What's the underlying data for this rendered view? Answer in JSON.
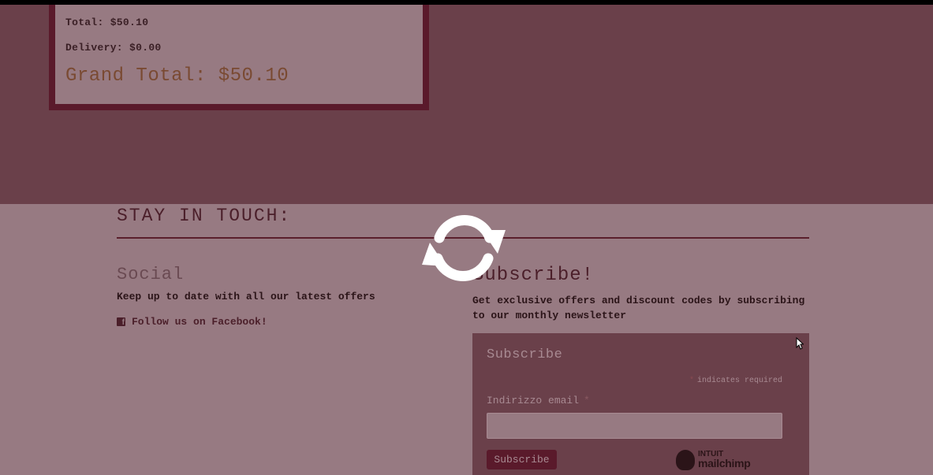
{
  "order": {
    "total_line": "Total: $50.10",
    "delivery_line": "Delivery: $0.00",
    "grand_total_line": "Grand Total: $50.10"
  },
  "footer": {
    "heading": "STAY IN TOUCH:",
    "social": {
      "heading": "Social",
      "text": "Keep up to date with all our latest offers",
      "facebook_link": "Follow us on Facebook!",
      "facebook_icon": "facebook-square-icon"
    },
    "subscribe": {
      "heading": "Subscribe!",
      "text": "Get exclusive offers and discount codes by subscribing to our monthly newsletter"
    },
    "form": {
      "title": "Subscribe",
      "required_note": "indicates required",
      "required_star": "*",
      "email_label": "Indirizzo email",
      "email_value": "",
      "button_label": "Subscribe",
      "brand_top": "INTUIT",
      "brand_bottom": "mailchimp"
    }
  },
  "overlay": {
    "icon": "refresh-icon",
    "cursor": "mouse-pointer-icon"
  },
  "colors": {
    "page_bg": "#6a404a",
    "footer_bg": "#977a82",
    "accent": "#5a1a2b"
  }
}
